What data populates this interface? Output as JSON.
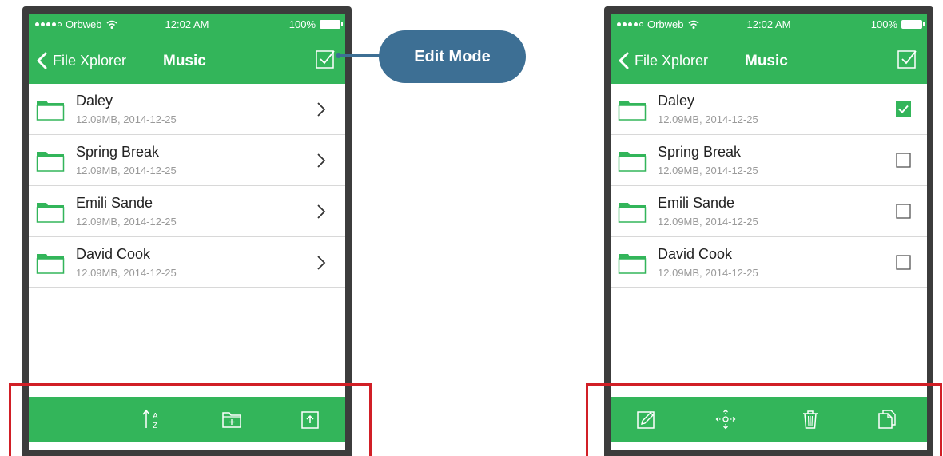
{
  "colors": {
    "brand_green": "#33b55a",
    "callout_blue": "#3d6f94",
    "highlight_red": "#d11f26"
  },
  "callout": {
    "label": "Edit Mode"
  },
  "left_phone": {
    "status": {
      "carrier": "Orbweb",
      "time": "12:02 AM",
      "battery": "100%"
    },
    "nav": {
      "back_label": "File Xplorer",
      "title": "Music",
      "edit_toggle_icon": "checkbox-icon"
    },
    "files": [
      {
        "name": "Daley",
        "meta": "12.09MB, 2014-12-25"
      },
      {
        "name": "Spring Break",
        "meta": "12.09MB, 2014-12-25"
      },
      {
        "name": "Emili Sande",
        "meta": "12.09MB, 2014-12-25"
      },
      {
        "name": "David Cook",
        "meta": "12.09MB, 2014-12-25"
      }
    ],
    "toolbar": [
      "sort-az-icon",
      "new-folder-icon",
      "upload-icon"
    ]
  },
  "right_phone": {
    "status": {
      "carrier": "Orbweb",
      "time": "12:02 AM",
      "battery": "100%"
    },
    "nav": {
      "back_label": "File Xplorer",
      "title": "Music",
      "edit_toggle_icon": "checkbox-icon"
    },
    "files": [
      {
        "name": "Daley",
        "meta": "12.09MB, 2014-12-25",
        "checked": true
      },
      {
        "name": "Spring Break",
        "meta": "12.09MB, 2014-12-25",
        "checked": false
      },
      {
        "name": "Emili Sande",
        "meta": "12.09MB, 2014-12-25",
        "checked": false
      },
      {
        "name": "David Cook",
        "meta": "12.09MB, 2014-12-25",
        "checked": false
      }
    ],
    "toolbar": [
      "rename-icon",
      "move-icon",
      "trash-icon",
      "copy-icon"
    ]
  }
}
